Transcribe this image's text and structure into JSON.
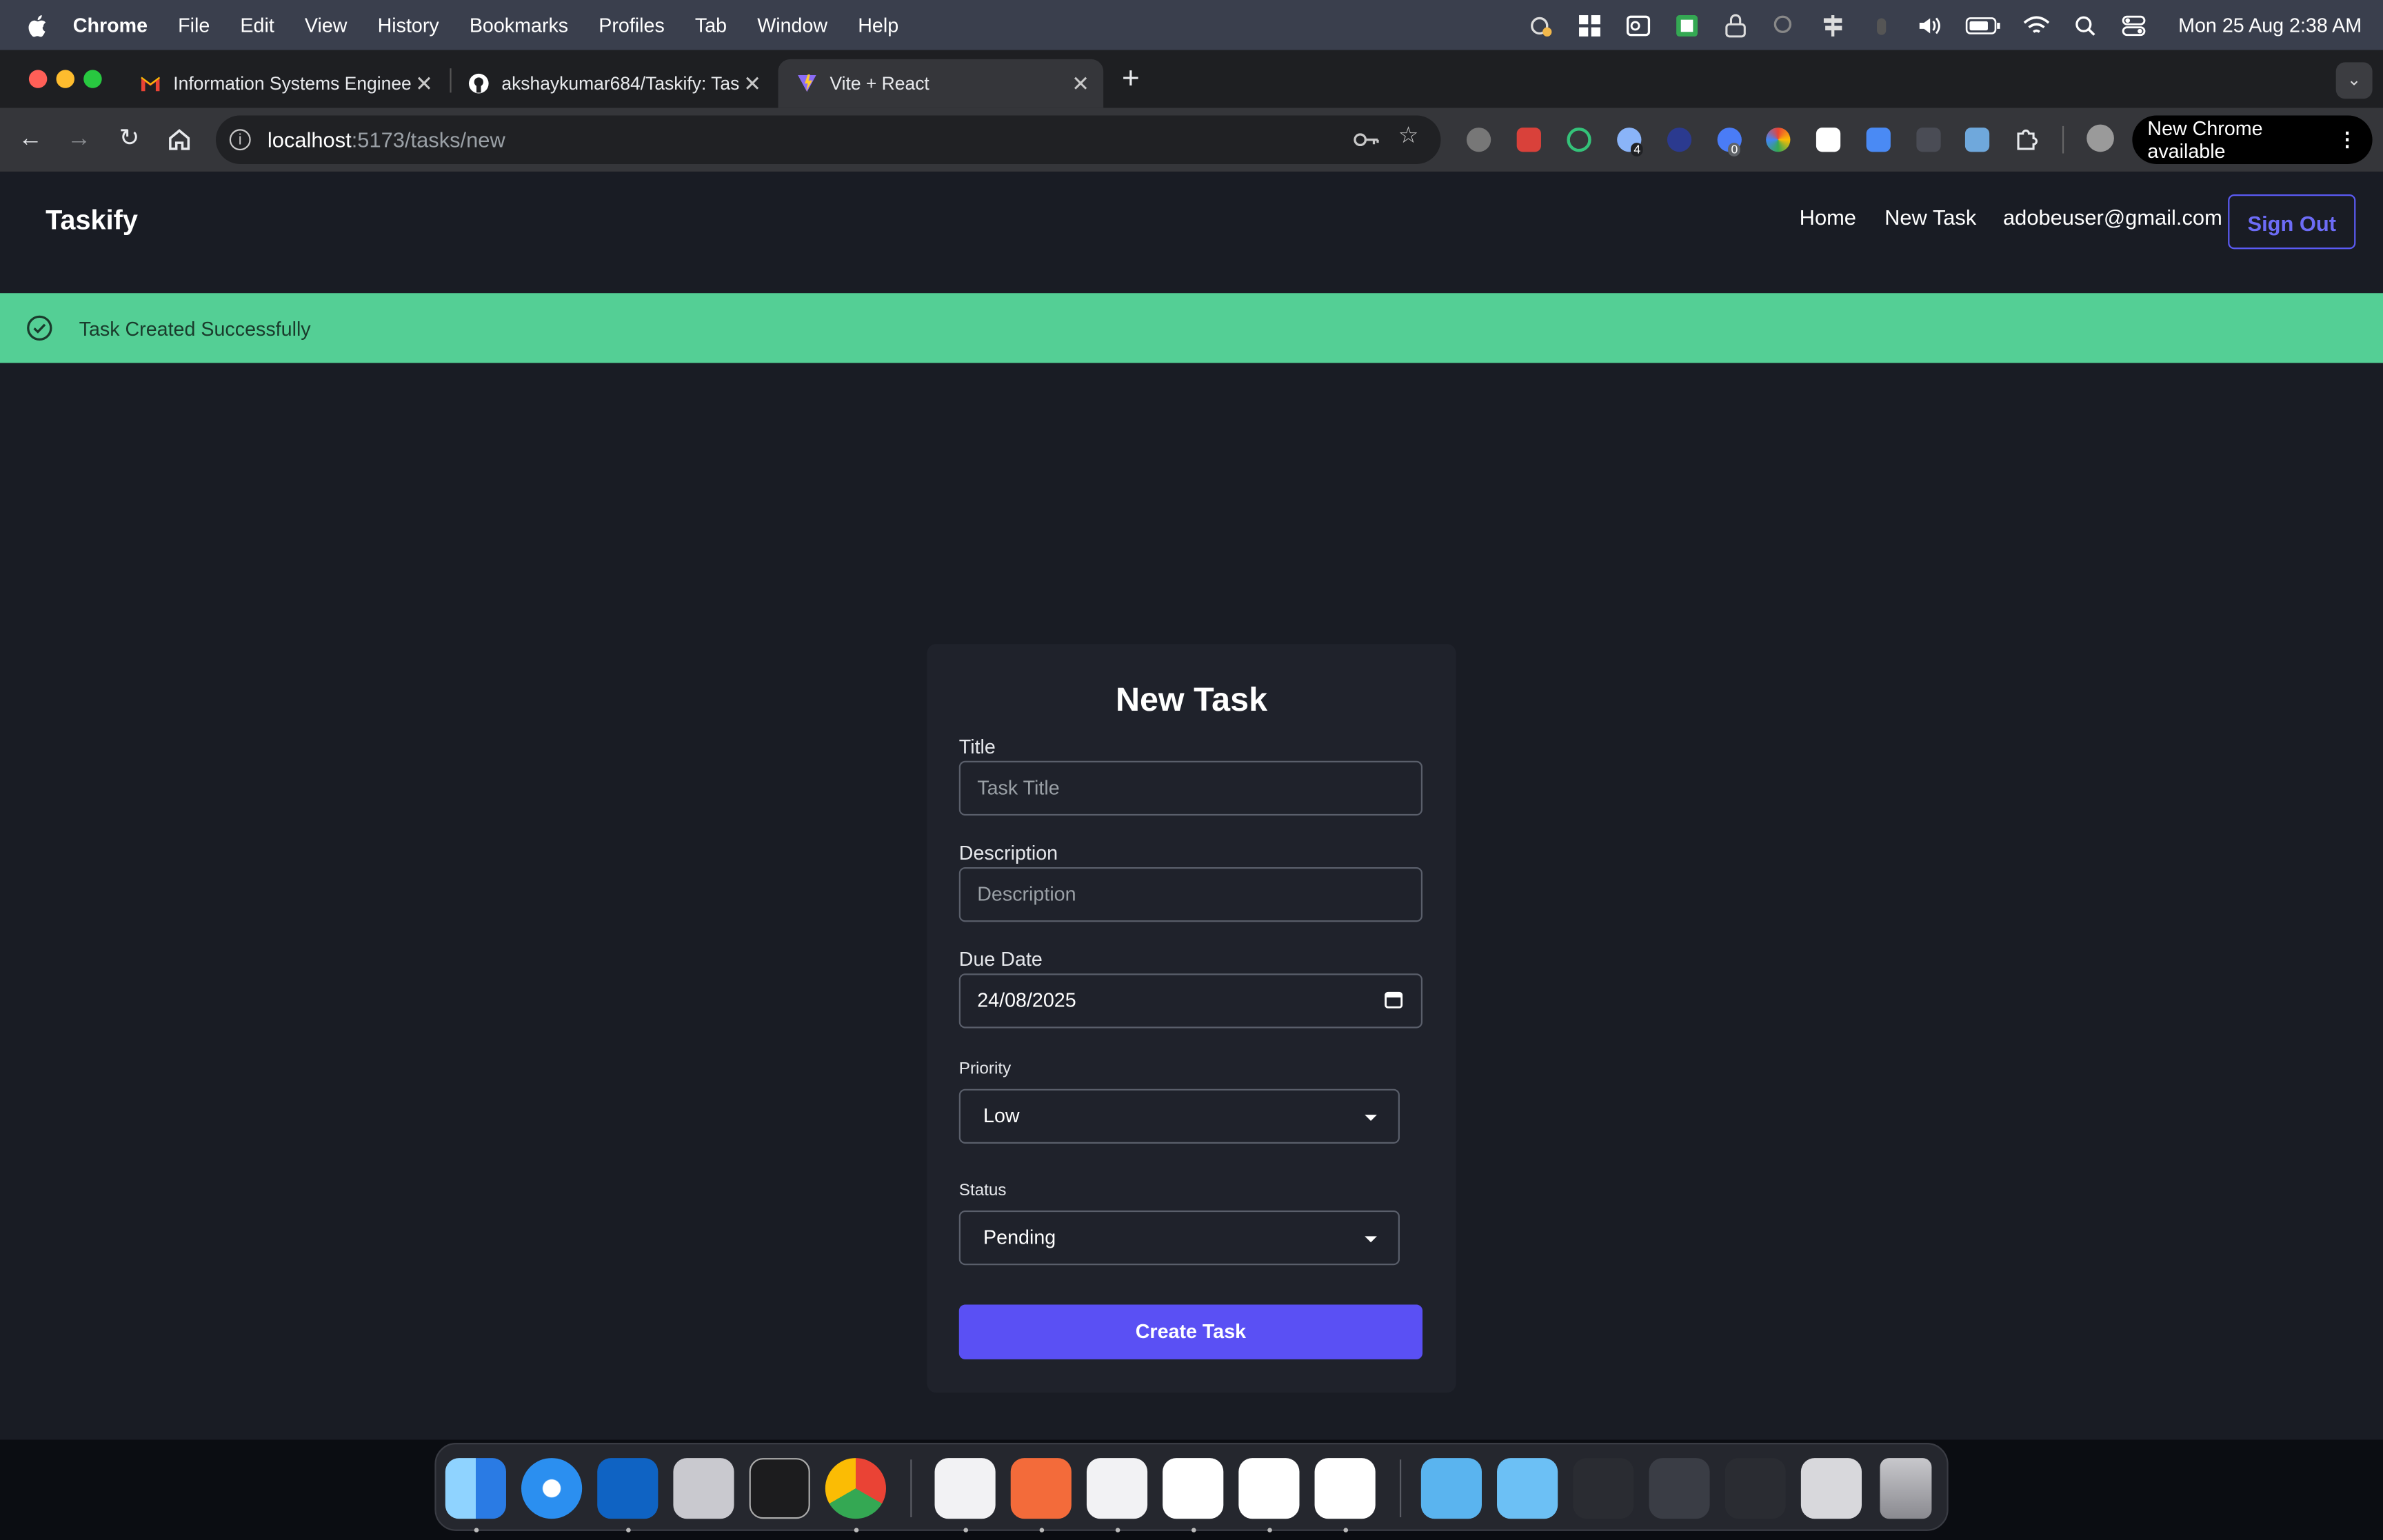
{
  "menubar": {
    "app": "Chrome",
    "items": [
      "File",
      "Edit",
      "View",
      "History",
      "Bookmarks",
      "Profiles",
      "Tab",
      "Window",
      "Help"
    ],
    "clock": "Mon 25 Aug  2:38 AM"
  },
  "browser": {
    "tabs": [
      {
        "title": "Information Systems Enginee",
        "icon": "gmail-icon"
      },
      {
        "title": "akshaykumar684/Taskify: Tas",
        "icon": "github-icon"
      },
      {
        "title": "Vite + React",
        "icon": "vite-icon",
        "active": true
      }
    ],
    "url_host": "localhost",
    "url_path": ":5173/tasks/new",
    "update_label": "New Chrome available",
    "extension_badges": {
      "ext4": "4",
      "ext6": "0"
    }
  },
  "app": {
    "brand": "Taskify",
    "nav": {
      "home": "Home",
      "new_task": "New Task",
      "user_email": "adobeuser@gmail.com",
      "sign_out": "Sign Out"
    },
    "toast": "Task Created Successfully",
    "form": {
      "heading": "New Task",
      "title_label": "Title",
      "title_placeholder": "Task Title",
      "description_label": "Description",
      "description_placeholder": "Description",
      "due_label": "Due Date",
      "due_value": "24/08/2025",
      "priority_label": "Priority",
      "priority_value": "Low",
      "status_label": "Status",
      "status_value": "Pending",
      "submit": "Create Task"
    }
  },
  "colors": {
    "accent": "#5a50f4",
    "toast_bg": "#54cf95",
    "page_bg": "#191c24",
    "card_bg": "#1f222b"
  }
}
